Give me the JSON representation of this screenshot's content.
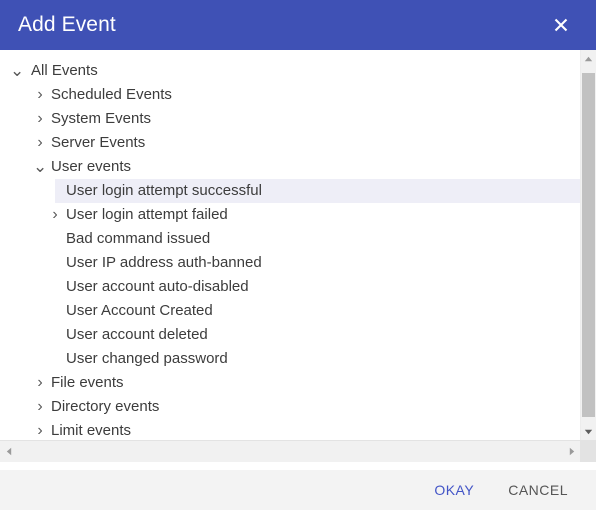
{
  "dialog": {
    "title": "Add Event",
    "close_icon": "close-icon",
    "header_color": "#3f51b5",
    "selection_color": "#eeeef7"
  },
  "tree": {
    "expanded_icon": "chevron-down-icon",
    "collapsed_icon": "chevron-right-icon",
    "rows": [
      {
        "label": "All Events",
        "level": 1,
        "state": "expanded",
        "selected": false
      },
      {
        "label": "Scheduled Events",
        "level": 2,
        "state": "collapsed",
        "selected": false
      },
      {
        "label": "System Events",
        "level": 2,
        "state": "collapsed",
        "selected": false
      },
      {
        "label": "Server Events",
        "level": 2,
        "state": "collapsed",
        "selected": false
      },
      {
        "label": "User events",
        "level": 2,
        "state": "expanded",
        "selected": false
      },
      {
        "label": "User login attempt successful",
        "level": 3,
        "state": "leaf",
        "selected": true
      },
      {
        "label": "User login attempt failed",
        "level": 3,
        "state": "collapsed",
        "selected": false
      },
      {
        "label": "Bad command issued",
        "level": 3,
        "state": "leaf",
        "selected": false
      },
      {
        "label": "User IP address auth-banned",
        "level": 3,
        "state": "leaf",
        "selected": false
      },
      {
        "label": "User account auto-disabled",
        "level": 3,
        "state": "leaf",
        "selected": false
      },
      {
        "label": "User Account Created",
        "level": 3,
        "state": "leaf",
        "selected": false
      },
      {
        "label": "User account deleted",
        "level": 3,
        "state": "leaf",
        "selected": false
      },
      {
        "label": "User changed password",
        "level": 3,
        "state": "leaf",
        "selected": false
      },
      {
        "label": "File events",
        "level": 2,
        "state": "collapsed",
        "selected": false
      },
      {
        "label": "Directory events",
        "level": 2,
        "state": "collapsed",
        "selected": false
      },
      {
        "label": "Limit events",
        "level": 2,
        "state": "collapsed",
        "selected": false
      }
    ]
  },
  "scrollbars": {
    "vertical": {
      "up_icon": "scroll-up-arrow-icon",
      "down_icon": "scroll-down-arrow-icon"
    },
    "horizontal": {
      "left_icon": "scroll-left-arrow-icon",
      "right_icon": "scroll-right-arrow-icon"
    }
  },
  "footer": {
    "okay_label": "OKAY",
    "cancel_label": "CANCEL",
    "okay_color": "#4355c7",
    "cancel_color": "#555555"
  }
}
